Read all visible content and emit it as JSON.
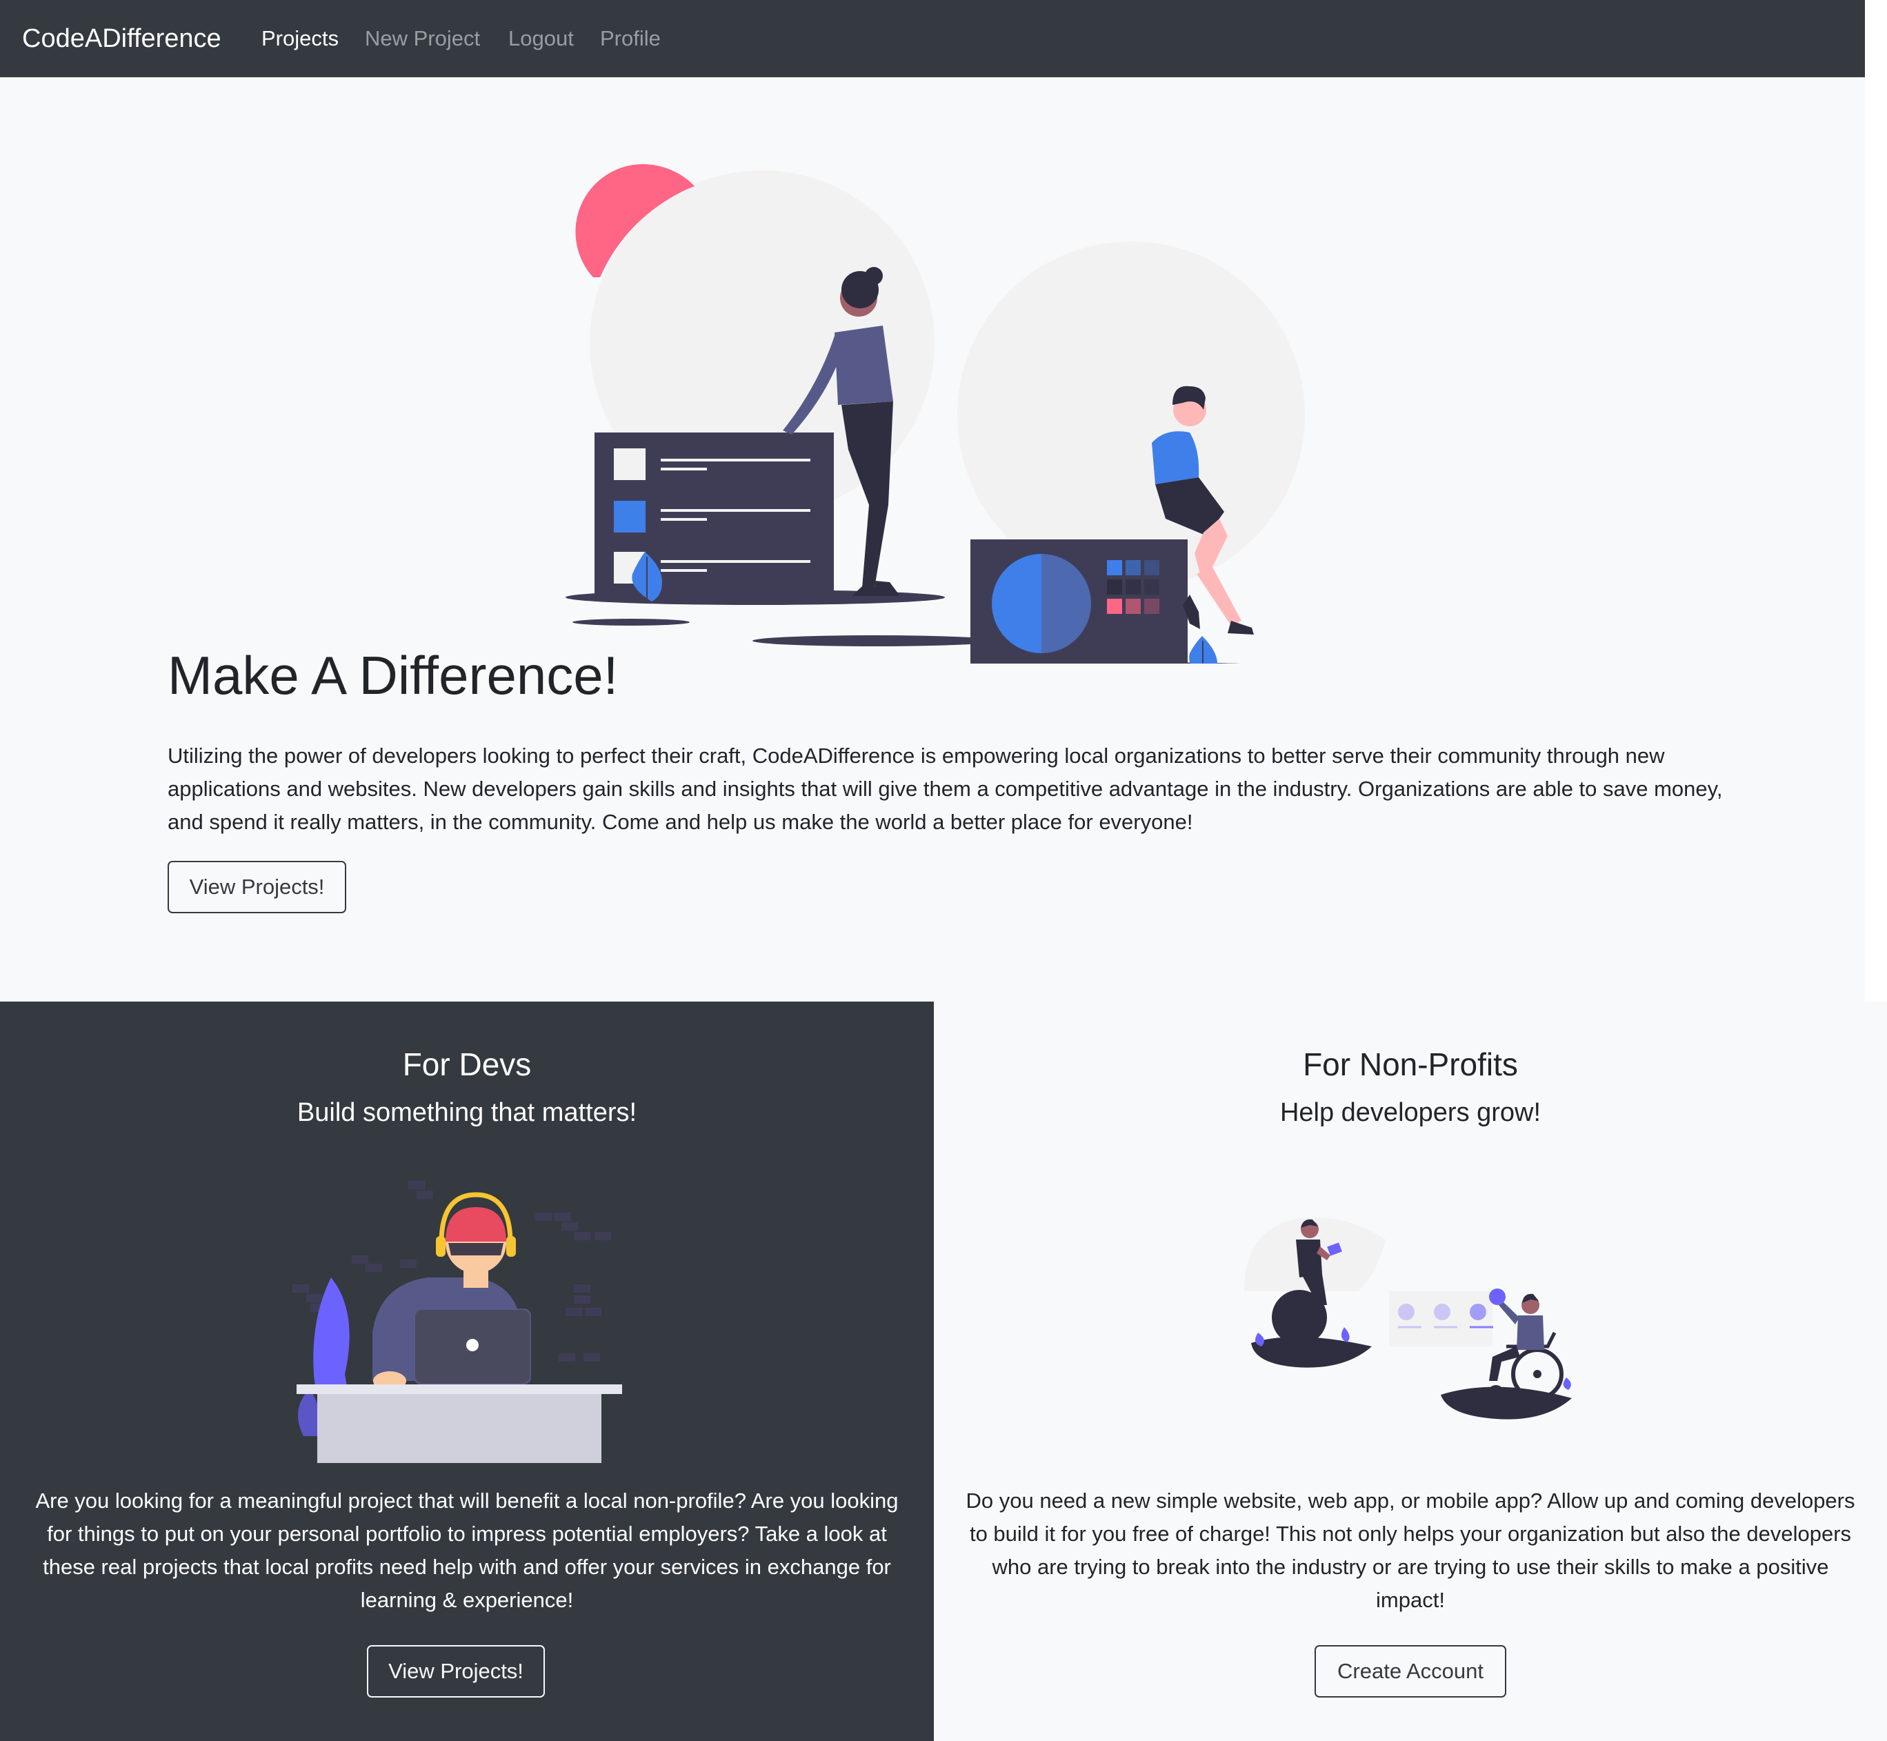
{
  "navbar": {
    "brand": "CodeADifference",
    "links": [
      {
        "label": "Projects",
        "active": true
      },
      {
        "label": "New Project",
        "active": false
      },
      {
        "label": "Logout",
        "active": false
      },
      {
        "label": "Profile",
        "active": false
      }
    ]
  },
  "hero": {
    "title": "Make A Difference!",
    "text": "Utilizing the power of developers looking to perfect their craft, CodeADifference is empowering local organizations to better serve their community through new applications and websites. New developers gain skills and insights that will give them a competitive advantage in the industry. Organizations are able to save money, and spend it really matters, in the community. Come and help us make the world a better place for everyone!",
    "button": "View Projects!"
  },
  "devs": {
    "title": "For Devs",
    "subtitle": "Build something that matters!",
    "text": "Are you looking for a meaningful project that will benefit a local non-profile? Are you looking for things to put on your personal portfolio to impress potential employers? Take a look at these real projects that local profits need help with and offer your services in exchange for learning & experience!",
    "button": "View Projects!"
  },
  "nonprofits": {
    "title": "For Non-Profits",
    "subtitle": "Help developers grow!",
    "text": "Do you need a new simple website, web app, or mobile app? Allow up and coming developers to build it for you free of charge! This not only helps your organization but also the developers who are trying to break into the industry or are trying to use their skills to make a positive impact!",
    "button": "Create Account"
  },
  "colors": {
    "navbar_bg": "#343a40",
    "page_bg": "#f8f9fa",
    "accent_blue": "#3f7fe9",
    "accent_pink": "#ff6584",
    "accent_purple": "#6c63ff",
    "dark_navy": "#3f3d56"
  }
}
